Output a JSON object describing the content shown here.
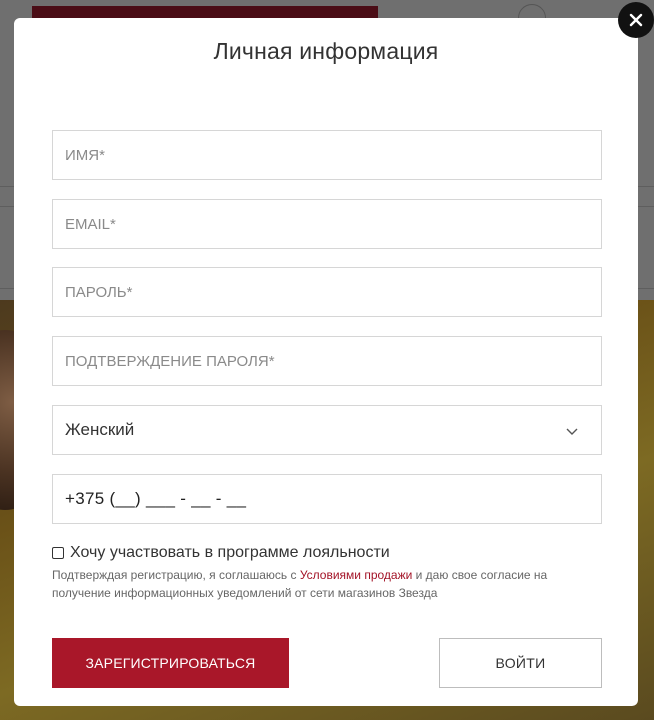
{
  "modal": {
    "title": "Личная информация",
    "close_icon": "close-icon"
  },
  "form": {
    "name_placeholder": "ИМЯ*",
    "email_placeholder": "EMAIL*",
    "password_placeholder": "ПАРОЛЬ*",
    "password_confirm_placeholder": "ПОДТВЕРЖДЕНИЕ ПАРОЛЯ*",
    "gender_value": "Женский",
    "phone_value": "+375 (__) ___ - __ - __"
  },
  "loyalty": {
    "checkbox_label": "Хочу участвовать в программе лояльности",
    "checked": false
  },
  "consent": {
    "text_before": "Подтверждая регистрацию, я соглашаюсь с ",
    "link_text": "Условиями продажи",
    "text_after": " и даю свое согласие на получение информационных уведомлений от сети магазинов Звезда"
  },
  "buttons": {
    "register_label": "ЗАРЕГИСТРИРОВАТЬСЯ",
    "login_label": "ВОЙТИ"
  },
  "colors": {
    "accent": "#a91729",
    "overlay": "#6f6f6f"
  }
}
